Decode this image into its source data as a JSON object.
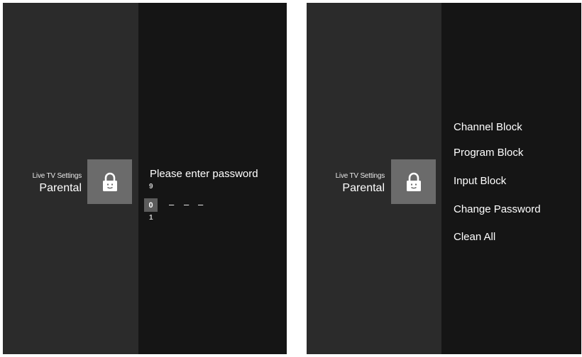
{
  "left_screen": {
    "breadcrumb_small": "Live TV Settings",
    "breadcrumb_title": "Parental",
    "password_prompt": "Please enter password",
    "digit_above": "9",
    "digit_selected": "0",
    "digit_below": "1",
    "placeholder_dashes": [
      "–",
      "–",
      "–"
    ]
  },
  "right_screen": {
    "breadcrumb_small": "Live TV Settings",
    "breadcrumb_title": "Parental",
    "menu_items": [
      "Channel Block",
      "Program Block",
      "Input Block",
      "Change Password",
      "Clean All"
    ]
  },
  "icons": {
    "lock": "lock-face-icon"
  },
  "colors": {
    "side_panel": "#2b2b2b",
    "main_panel": "#151515",
    "tile": "#6b6b6b",
    "digit_highlight": "#5c5c5c"
  }
}
